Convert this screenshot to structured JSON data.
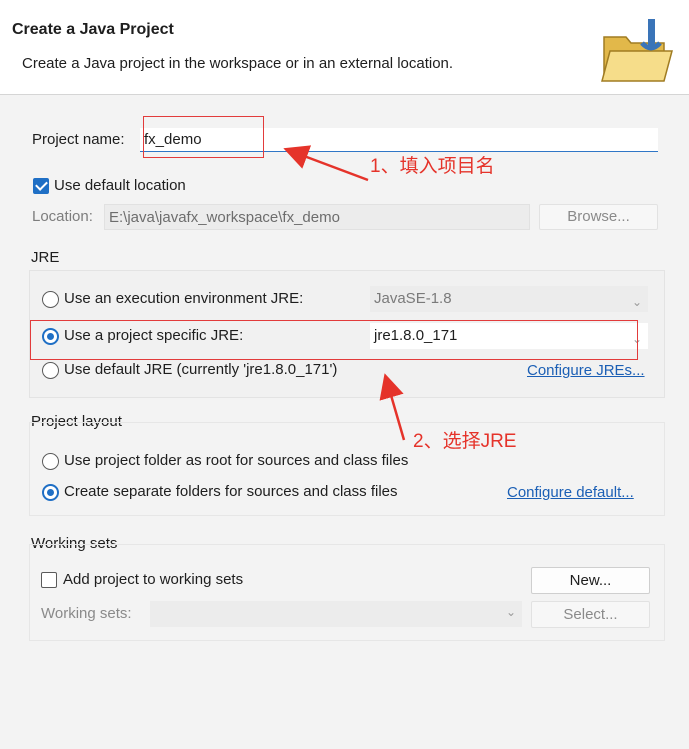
{
  "header": {
    "title": "Create a Java Project",
    "description": "Create a Java project in the workspace or in an external location."
  },
  "project": {
    "name_label": "Project name:",
    "name_value": "fx_demo",
    "use_default_location_label": "Use default location",
    "use_default_location_checked": true,
    "location_label": "Location:",
    "location_value": "E:\\java\\javafx_workspace\\fx_demo",
    "browse_label": "Browse..."
  },
  "jre": {
    "group_title": "JRE",
    "options": [
      {
        "label": "Use an execution environment JRE:",
        "checked": false,
        "value": "JavaSE-1.8"
      },
      {
        "label": "Use a project specific JRE:",
        "checked": true,
        "value": "jre1.8.0_171"
      },
      {
        "label": "Use default JRE (currently 'jre1.8.0_171')",
        "checked": false
      }
    ],
    "configure_link": "Configure JREs..."
  },
  "layout": {
    "group_title": "Project layout",
    "options": [
      {
        "label": "Use project folder as root for sources and class files",
        "checked": false
      },
      {
        "label": "Create separate folders for sources and class files",
        "checked": true
      }
    ],
    "configure_link": "Configure default..."
  },
  "working_sets": {
    "group_title": "Working sets",
    "add_label": "Add project to working sets",
    "add_checked": false,
    "new_button": "New...",
    "sets_label": "Working sets:",
    "select_button": "Select..."
  },
  "annotations": {
    "step1": "1、填入项目名",
    "step2": "2、选择JRE",
    "color": "#e5332a"
  }
}
